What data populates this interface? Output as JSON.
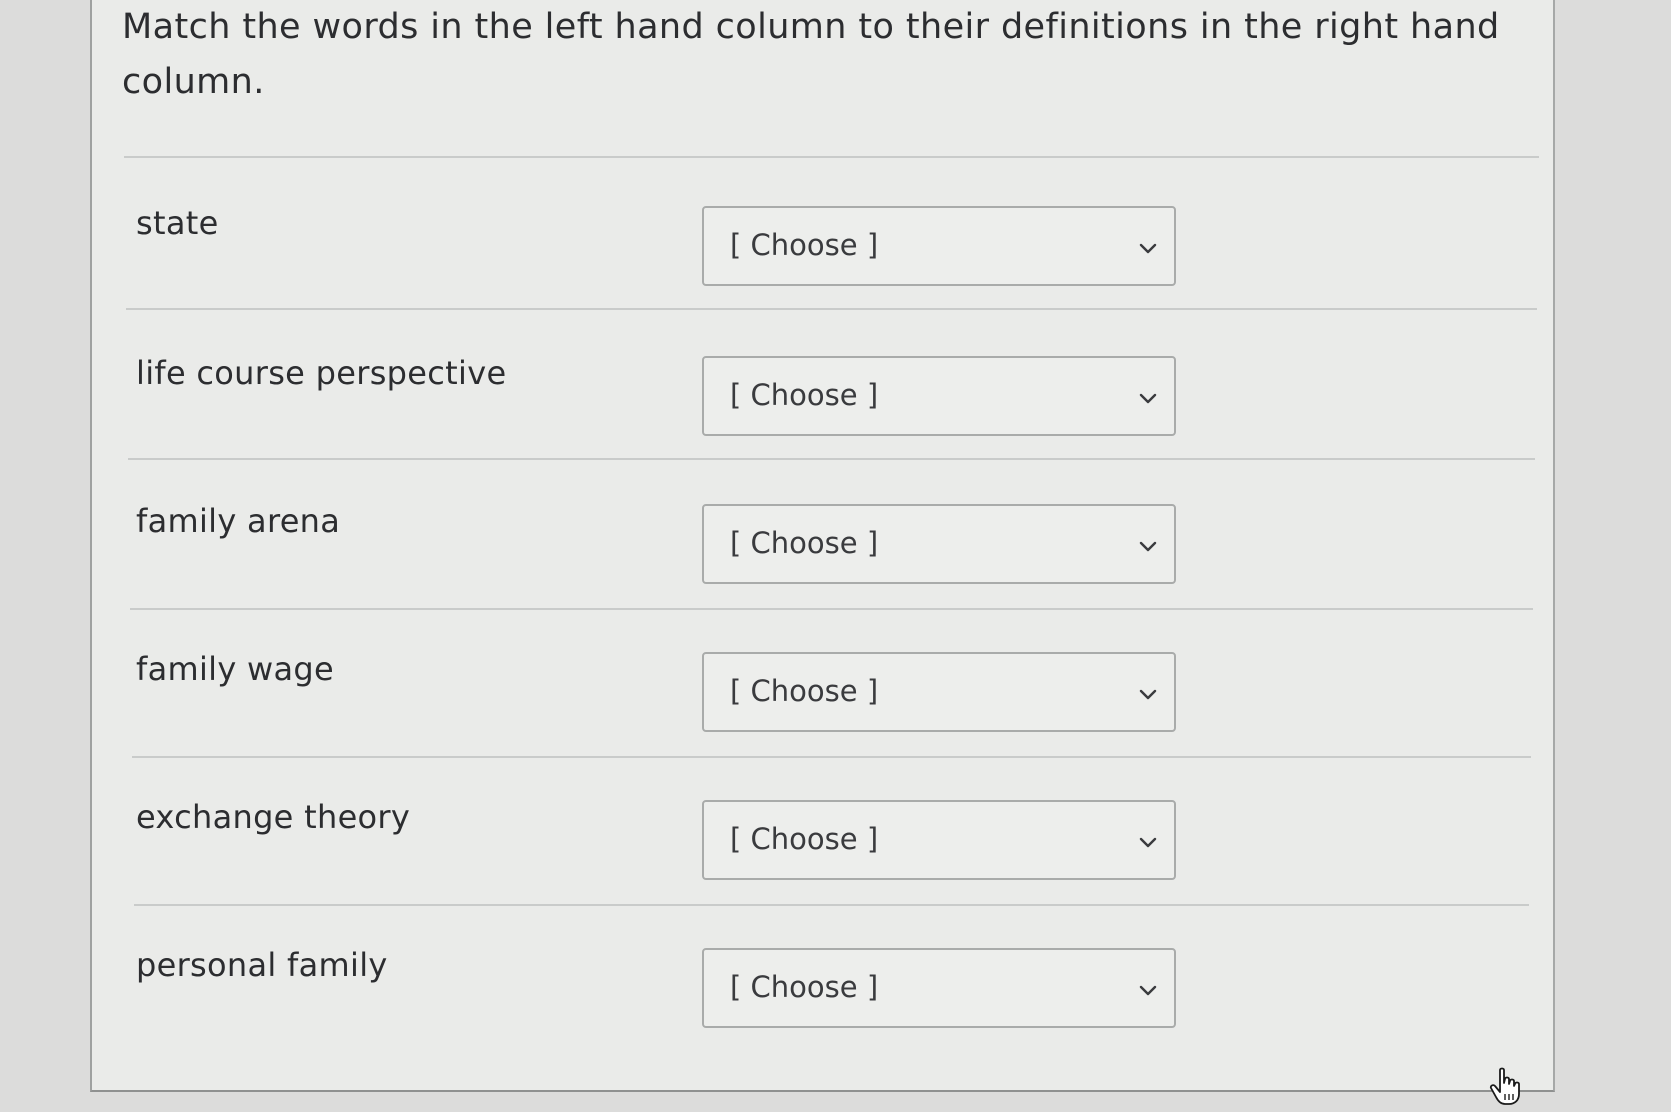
{
  "question": {
    "text": "Match the words in the left hand column to their definitions in the right hand column."
  },
  "rows": [
    {
      "term": "state",
      "selected": "[ Choose ]"
    },
    {
      "term": "life course perspective",
      "selected": "[ Choose ]"
    },
    {
      "term": "family arena",
      "selected": "[ Choose ]"
    },
    {
      "term": "family wage",
      "selected": "[ Choose ]"
    },
    {
      "term": "exchange theory",
      "selected": "[ Choose ]"
    },
    {
      "term": "personal family",
      "selected": "[ Choose ]"
    }
  ],
  "icons": {
    "dropdown": "chevron-down-icon",
    "cursor": "hand-pointer-icon"
  }
}
